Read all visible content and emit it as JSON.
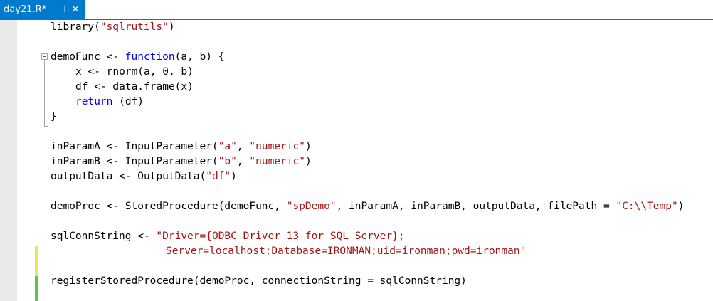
{
  "tab": {
    "title": "day21.R*",
    "pin_icon": "pin-icon",
    "close_icon": "close-icon",
    "accent_color": "#007acc"
  },
  "change_marks": {
    "unsaved_color": "#e7e755",
    "saved_color": "#5fc34f"
  },
  "code": {
    "library_fn": "library(",
    "library_arg": "\"sqlrutils\"",
    "library_end": ")",
    "func_lhs": "demoFunc <- ",
    "func_kw": "function",
    "func_args": "(a, b) {",
    "body_x": "x <- rnorm(a, 0, b)",
    "body_df": "df <- data.frame(x)",
    "return_kw": "return",
    "return_args": " (df)",
    "close_brace": "}",
    "paramA_pre": "inParamA <- InputParameter(",
    "paramA_name": "\"a\"",
    "paramA_sep": ", ",
    "paramA_type": "\"numeric\"",
    "paramA_end": ")",
    "paramB_pre": "inParamB <- InputParameter(",
    "paramB_name": "\"b\"",
    "paramB_sep": ", ",
    "paramB_type": "\"numeric\"",
    "paramB_end": ")",
    "output_pre": "outputData <- OutputData(",
    "output_name": "\"df\"",
    "output_end": ")",
    "proc_pre": "demoProc <- StoredProcedure(demoFunc, ",
    "proc_name": "\"spDemo\"",
    "proc_mid": ", inParamA, inParamB, outputData, filePath = ",
    "proc_path": "\"C:\\\\Temp\"",
    "proc_end": ")",
    "conn_pre": "sqlConnString <- ",
    "conn_str1": "\"Driver={ODBC Driver 13 for SQL Server};",
    "conn_str2": "Server=localhost;Database=IRONMAN;uid=ironman;pwd=ironman\"",
    "register": "registerStoredProcedure(demoProc, connectionString = sqlConnString)"
  }
}
